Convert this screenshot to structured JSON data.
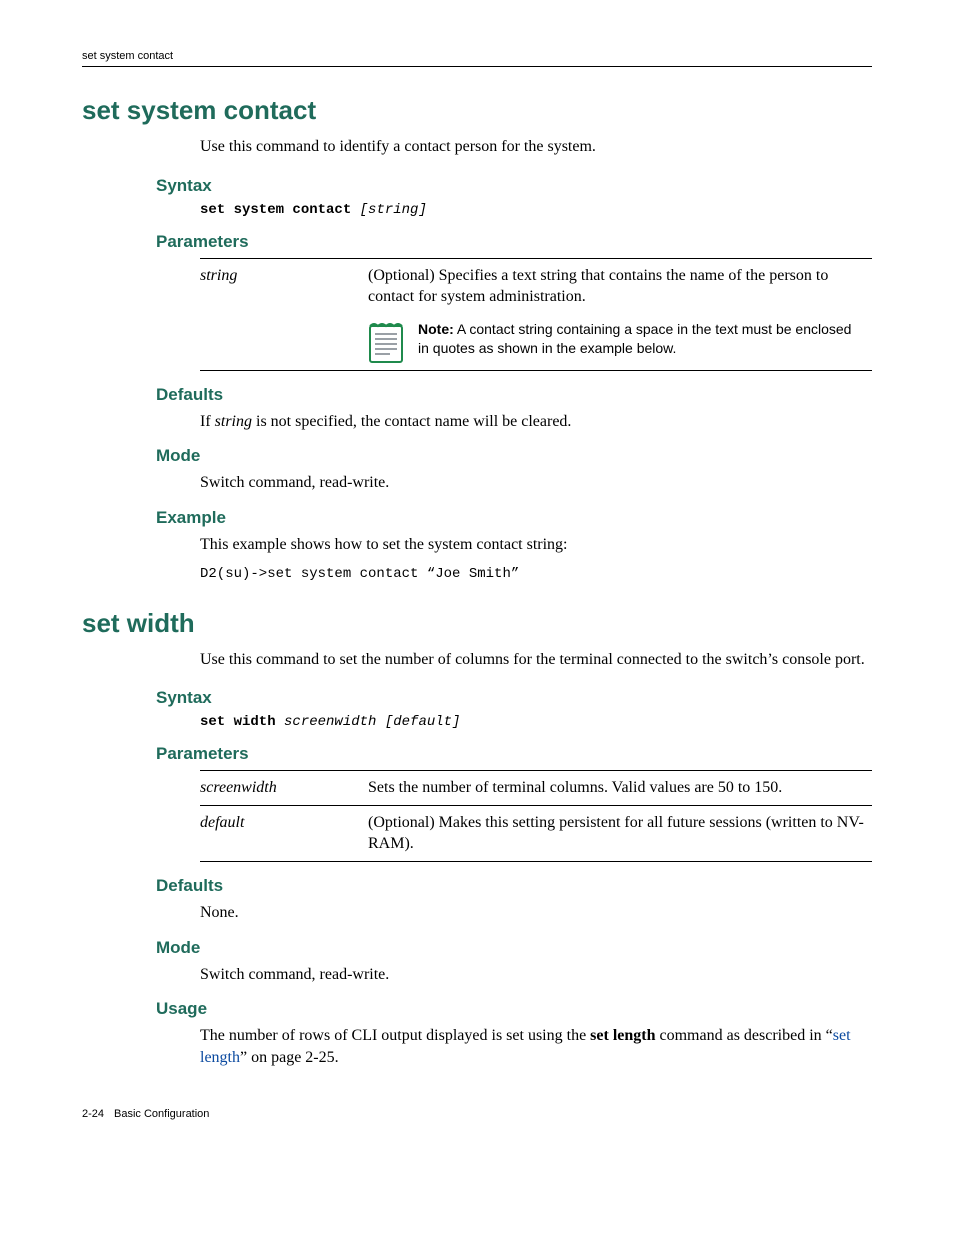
{
  "running_head": "set system contact",
  "sections": [
    {
      "title": "set system contact",
      "intro": "Use this command to identify a contact person for the system.",
      "syntax_heading": "Syntax",
      "syntax_kw": "set system contact",
      "syntax_args": " [string]",
      "parameters_heading": "Parameters",
      "params": [
        {
          "name": "string",
          "desc": "(Optional) Specifies a text string that contains the name of the person to contact for system administration."
        }
      ],
      "note_label": "Note:",
      "note_text": " A contact string containing a space in the text must be enclosed in quotes as shown in the example below.",
      "defaults_heading": "Defaults",
      "defaults_pre": "If ",
      "defaults_em": "string",
      "defaults_post": " is not specified, the contact name will be cleared.",
      "mode_heading": "Mode",
      "mode_text": "Switch command, read-write.",
      "example_heading": "Example",
      "example_text": "This example shows how to set the system contact string:",
      "example_code": "D2(su)->set system contact “Joe Smith”"
    },
    {
      "title": "set width",
      "intro": "Use this command to set the number of columns for the terminal connected to the switch’s console port.",
      "syntax_heading": "Syntax",
      "syntax_kw": "set width",
      "syntax_args": " screenwidth [default]",
      "parameters_heading": "Parameters",
      "params": [
        {
          "name": "screenwidth",
          "desc": "Sets the number of terminal columns. Valid values are 50 to 150."
        },
        {
          "name": "default",
          "desc": "(Optional) Makes this setting persistent for all future sessions (written to NV-RAM)."
        }
      ],
      "defaults_heading": "Defaults",
      "defaults_text": "None.",
      "mode_heading": "Mode",
      "mode_text": "Switch command, read-write.",
      "usage_heading": "Usage",
      "usage_pre": "The number of rows of CLI output displayed is set using the ",
      "usage_strong": "set length",
      "usage_mid": " command as described in “",
      "usage_link": "set length",
      "usage_post": "” on page 2-25."
    }
  ],
  "footer": {
    "page": "2-24",
    "chapter": "Basic Configuration"
  }
}
